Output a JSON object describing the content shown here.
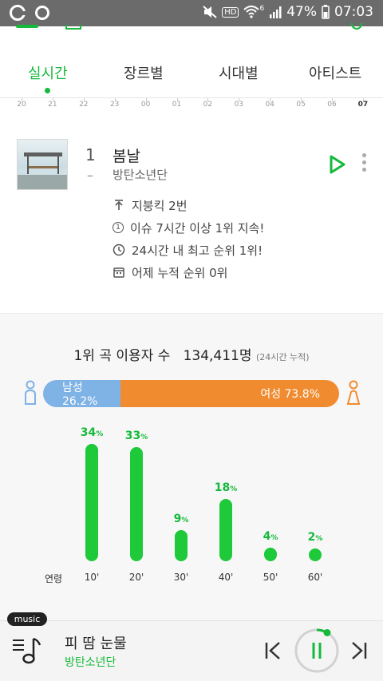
{
  "statusbar": {
    "battery": "47%",
    "time": "07:03",
    "network": "6",
    "icons": [
      "mute-icon",
      "hd-icon",
      "wifi-icon",
      "signal-icon",
      "battery-icon"
    ]
  },
  "tabs": [
    {
      "label": "실시간",
      "active": true
    },
    {
      "label": "장르별",
      "active": false
    },
    {
      "label": "시대별",
      "active": false
    },
    {
      "label": "아티스트",
      "active": false
    }
  ],
  "ruler": {
    "hours": [
      "20",
      "21",
      "22",
      "23",
      "00",
      "01",
      "02",
      "03",
      "04",
      "05",
      "06",
      "07"
    ],
    "active": "07"
  },
  "song": {
    "rank": "1",
    "change": "–",
    "title": "봄날",
    "artist": "방탄소년단",
    "info": [
      {
        "icon": "rise-icon",
        "text": "지붕킥 2번"
      },
      {
        "icon": "streak-icon",
        "text": "이슈 7시간 이상 1위 지속!"
      },
      {
        "icon": "clock-icon",
        "text": "24시간 내 최고 순위 1위!"
      },
      {
        "icon": "calendar-icon",
        "text": "어제 누적 순위 0위"
      }
    ]
  },
  "stats": {
    "users_label": "1위 곡 이용자 수",
    "users_count": "134,411명",
    "users_note": "(24시간 누적)",
    "male_label": "남성 26.2%",
    "female_label": "여성 73.8%",
    "male_share": 26.2,
    "colors": {
      "male": "#7fb2e5",
      "female": "#f18b2f",
      "accent": "#15b93b"
    }
  },
  "chart_data": {
    "type": "bar",
    "xlabel": "연령",
    "categories": [
      "10'",
      "20'",
      "30'",
      "40'",
      "50'",
      "60'"
    ],
    "values": [
      34,
      33,
      9,
      18,
      4,
      2
    ],
    "unit": "%"
  },
  "player": {
    "badge": "music",
    "title": "피 땀 눈물",
    "artist": "방탄소년단",
    "state": "playing"
  }
}
